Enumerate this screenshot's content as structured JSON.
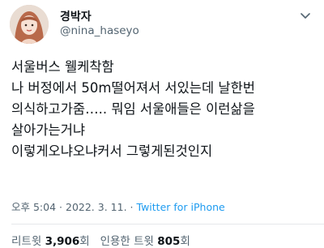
{
  "header": {
    "display_name": "경박자",
    "handle": "@nina_haseyo",
    "more_icon": "chevron-down-icon"
  },
  "tweet": {
    "lines": [
      "서울버스 웰케착함",
      "나 버정에서 50m떨어져서 서있는데 날한번",
      "의식하고가줌….. 뭐임 서울애들은 이런삶을",
      "살아가는거냐",
      "이렇게오냐오냐커서 그렇게된것인지"
    ]
  },
  "meta": {
    "time": "오후 5:04",
    "separator": "·",
    "date": "2022. 3. 11.",
    "source": "Twitter for iPhone"
  },
  "stats": {
    "retweets_label": "리트윗",
    "retweets_count": "3,906",
    "retweets_unit": "회",
    "quotes_label": "인용한 트윗",
    "quotes_count": "805",
    "quotes_unit": "회"
  },
  "colors": {
    "text": "#0f1419",
    "secondary": "#536471",
    "link": "#1d9bf0",
    "divider": "#e5e8eb"
  }
}
